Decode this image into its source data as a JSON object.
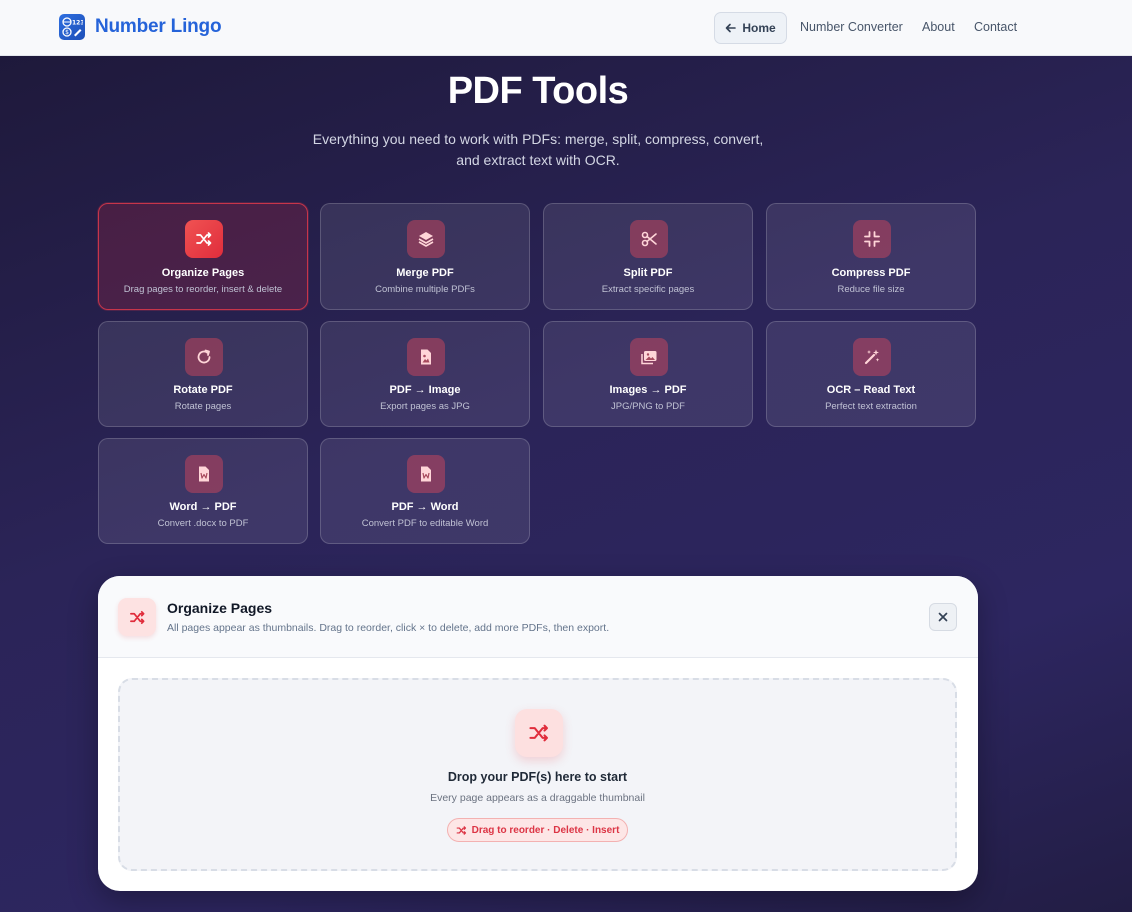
{
  "navbar": {
    "brand": "Number Lingo",
    "home": "Home",
    "links": [
      "Number Converter",
      "About",
      "Contact"
    ]
  },
  "hero": {
    "title": "PDF Tools",
    "subtitle": "Everything you need to work with PDFs: merge, split, compress, convert, and extract text with OCR."
  },
  "tools": [
    {
      "title": "Organize Pages",
      "desc": "Drag pages to reorder, insert & delete",
      "icon": "shuffle-icon",
      "active": true
    },
    {
      "title": "Merge PDF",
      "desc": "Combine multiple PDFs",
      "icon": "layers-icon"
    },
    {
      "title": "Split PDF",
      "desc": "Extract specific pages",
      "icon": "scissors-icon"
    },
    {
      "title": "Compress PDF",
      "desc": "Reduce file size",
      "icon": "compress-icon"
    },
    {
      "title": "Rotate PDF",
      "desc": "Rotate pages",
      "icon": "rotate-icon"
    },
    {
      "title": "PDF → Image",
      "desc": "Export pages as JPG",
      "icon": "file-image-icon"
    },
    {
      "title": "Images → PDF",
      "desc": "JPG/PNG to PDF",
      "icon": "images-icon"
    },
    {
      "title": "OCR – Read Text",
      "desc": "Perfect text extraction",
      "icon": "magic-wand-icon"
    },
    {
      "title": "Word → PDF",
      "desc": "Convert .docx to PDF",
      "icon": "word-file-icon"
    },
    {
      "title": "PDF → Word",
      "desc": "Convert PDF to editable Word",
      "icon": "word-file-icon"
    }
  ],
  "panel": {
    "title": "Organize Pages",
    "subtitle": "All pages appear as thumbnails. Drag to reorder, click × to delete, add more PDFs, then export.",
    "close": "×",
    "drop_title": "Drop your PDF(s) here to start",
    "drop_sub": "Every page appears as a draggable thumbnail",
    "drop_pill": "Drag to reorder · Delete · Insert"
  },
  "colors": {
    "brand": "#2563d9",
    "accent": "#e02d3c",
    "background": "#2b2458"
  }
}
